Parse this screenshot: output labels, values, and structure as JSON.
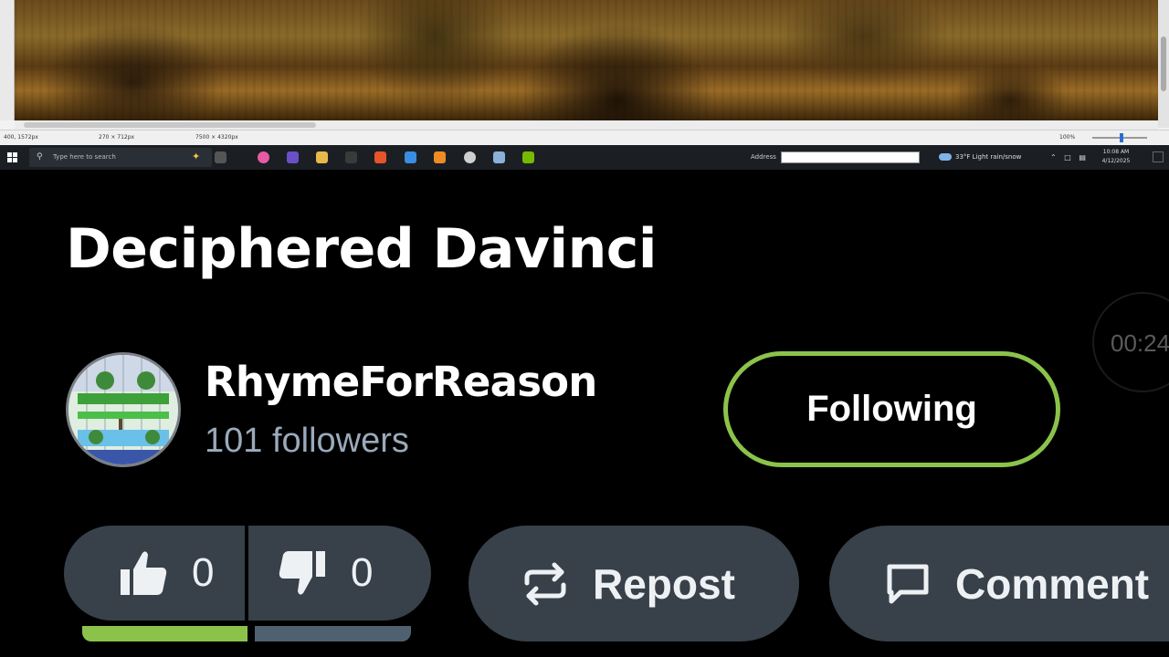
{
  "video_frame": {
    "status_bar": {
      "position_readout": "400, 1572px",
      "selection_readout": "270 × 712px",
      "document_size": "7500 × 4320px",
      "zoom": "100%"
    },
    "taskbar": {
      "search_placeholder": "Type here to search",
      "address_label": "Address",
      "weather": "33°F  Light rain/snow",
      "time": "10:08 AM",
      "date": "4/12/2025"
    }
  },
  "video": {
    "title": "Deciphered Davinci",
    "timer": "00:24"
  },
  "channel": {
    "name": "RhymeForReason",
    "followers": "101 followers",
    "follow_label": "Following",
    "accent_color": "#8bc34a"
  },
  "actions": {
    "like_count": "0",
    "dislike_count": "0",
    "like_ratio": 1.0,
    "repost_label": "Repost",
    "comment_label": "Comment"
  }
}
